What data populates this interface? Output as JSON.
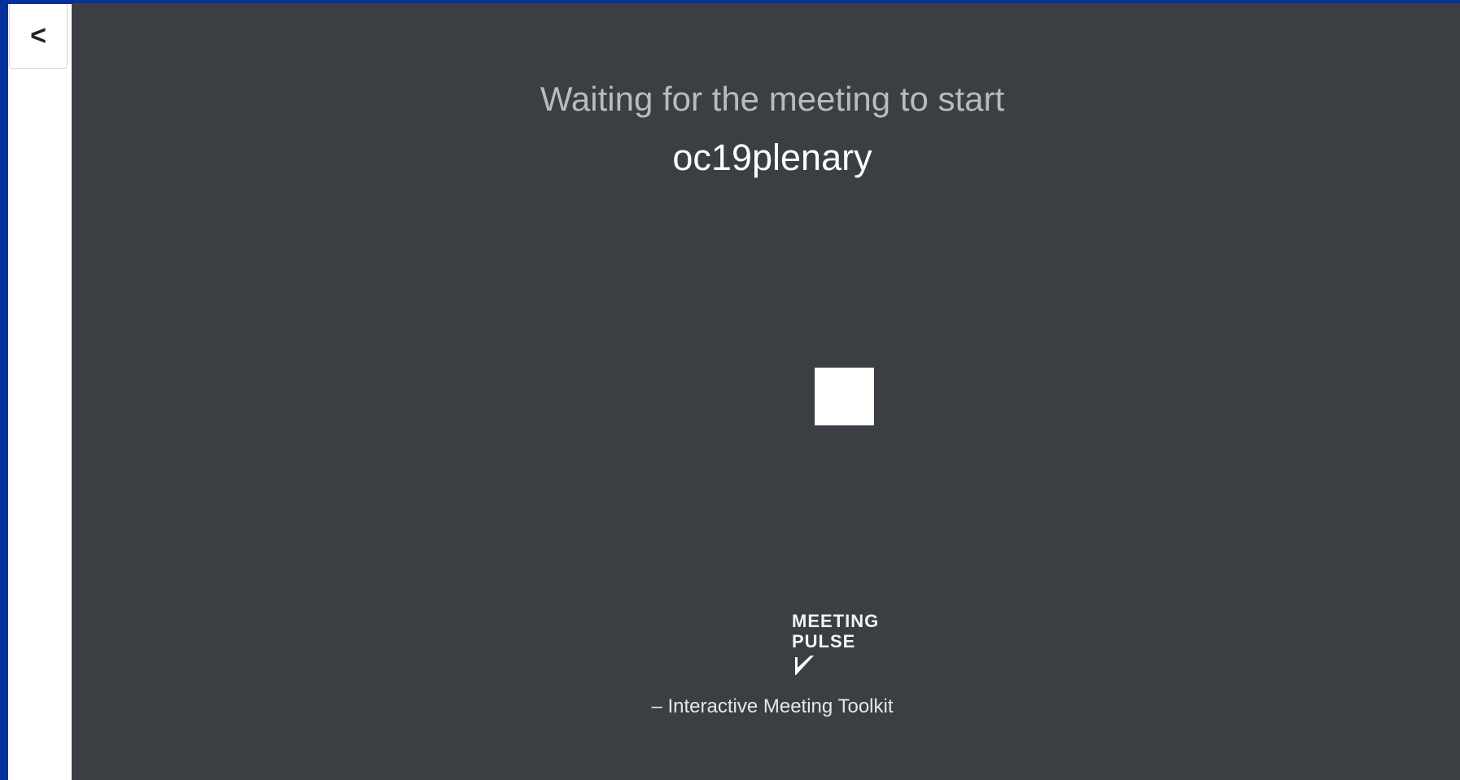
{
  "sidebar": {
    "back_label": "<"
  },
  "main": {
    "status_title": "Waiting for the meeting to start",
    "meeting_name": "oc19plenary",
    "brand": {
      "line1": "MEETING",
      "line2": "PULSE",
      "icon": "pulse-check-icon"
    },
    "tagline": "– Interactive Meeting Toolkit"
  },
  "colors": {
    "frame": "#05329a",
    "sidebar": "#ffffff",
    "main_background": "#3b3f43",
    "title_text": "#b7bcc0",
    "meeting_name_text": "#ffffff",
    "loading_indicator": "#ffffff"
  }
}
